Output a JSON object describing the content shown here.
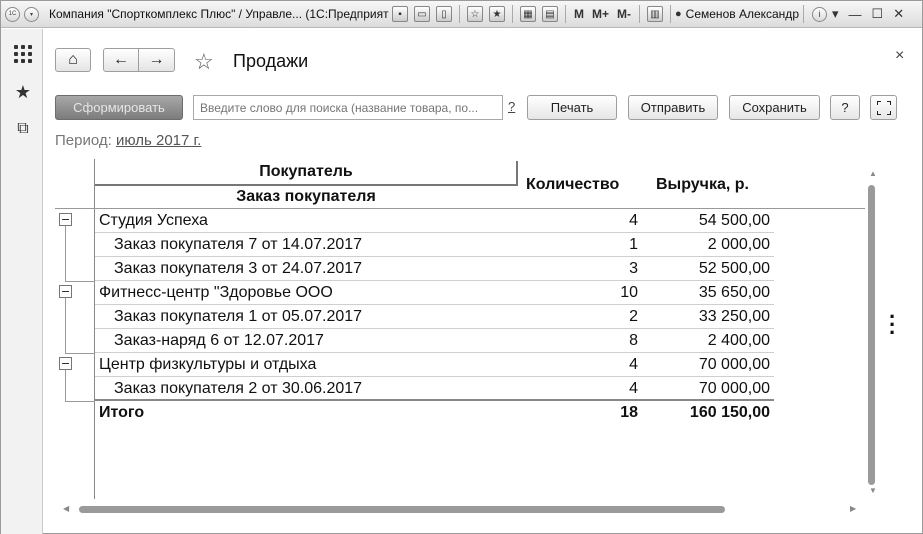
{
  "titlebar": {
    "title": "Компания \"Спорткомплекс Плюс\" / Управле... (1С:Предприятие)",
    "m_labels": [
      "M",
      "M+",
      "M-"
    ],
    "user": "Семенов Александр"
  },
  "form": {
    "title": "Продажи"
  },
  "toolbar": {
    "generate_label": "Сформировать",
    "search_placeholder": "Введите слово для поиска (название товара, по...",
    "search_help": "?",
    "print_label": "Печать",
    "send_label": "Отправить",
    "save_label": "Сохранить",
    "help_label": "?"
  },
  "period": {
    "label": "Период:",
    "value": "июль 2017 г."
  },
  "report": {
    "headers": {
      "buyer": "Покупатель",
      "order": "Заказ покупателя",
      "quantity": "Количество",
      "revenue": "Выручка, р."
    },
    "rows": [
      {
        "name": "Студия Успеха",
        "qty": "4",
        "rev": "54 500,00",
        "level": 0
      },
      {
        "name": "Заказ покупателя 7 от 14.07.2017",
        "qty": "1",
        "rev": "2 000,00",
        "level": 1
      },
      {
        "name": "Заказ покупателя 3 от 24.07.2017",
        "qty": "3",
        "rev": "52 500,00",
        "level": 1
      },
      {
        "name": "Фитнесс-центр \"Здоровье ООО",
        "qty": "10",
        "rev": "35 650,00",
        "level": 0
      },
      {
        "name": "Заказ покупателя 1 от 05.07.2017",
        "qty": "2",
        "rev": "33 250,00",
        "level": 1
      },
      {
        "name": "Заказ-наряд 6 от 12.07.2017",
        "qty": "8",
        "rev": "2 400,00",
        "level": 1
      },
      {
        "name": "Центр физкультуры и отдыха",
        "qty": "4",
        "rev": "70 000,00",
        "level": 0
      },
      {
        "name": "Заказ покупателя 2 от 30.06.2017",
        "qty": "4",
        "rev": "70 000,00",
        "level": 1
      }
    ],
    "total": {
      "name": "Итого",
      "qty": "18",
      "rev": "160 150,00"
    }
  }
}
